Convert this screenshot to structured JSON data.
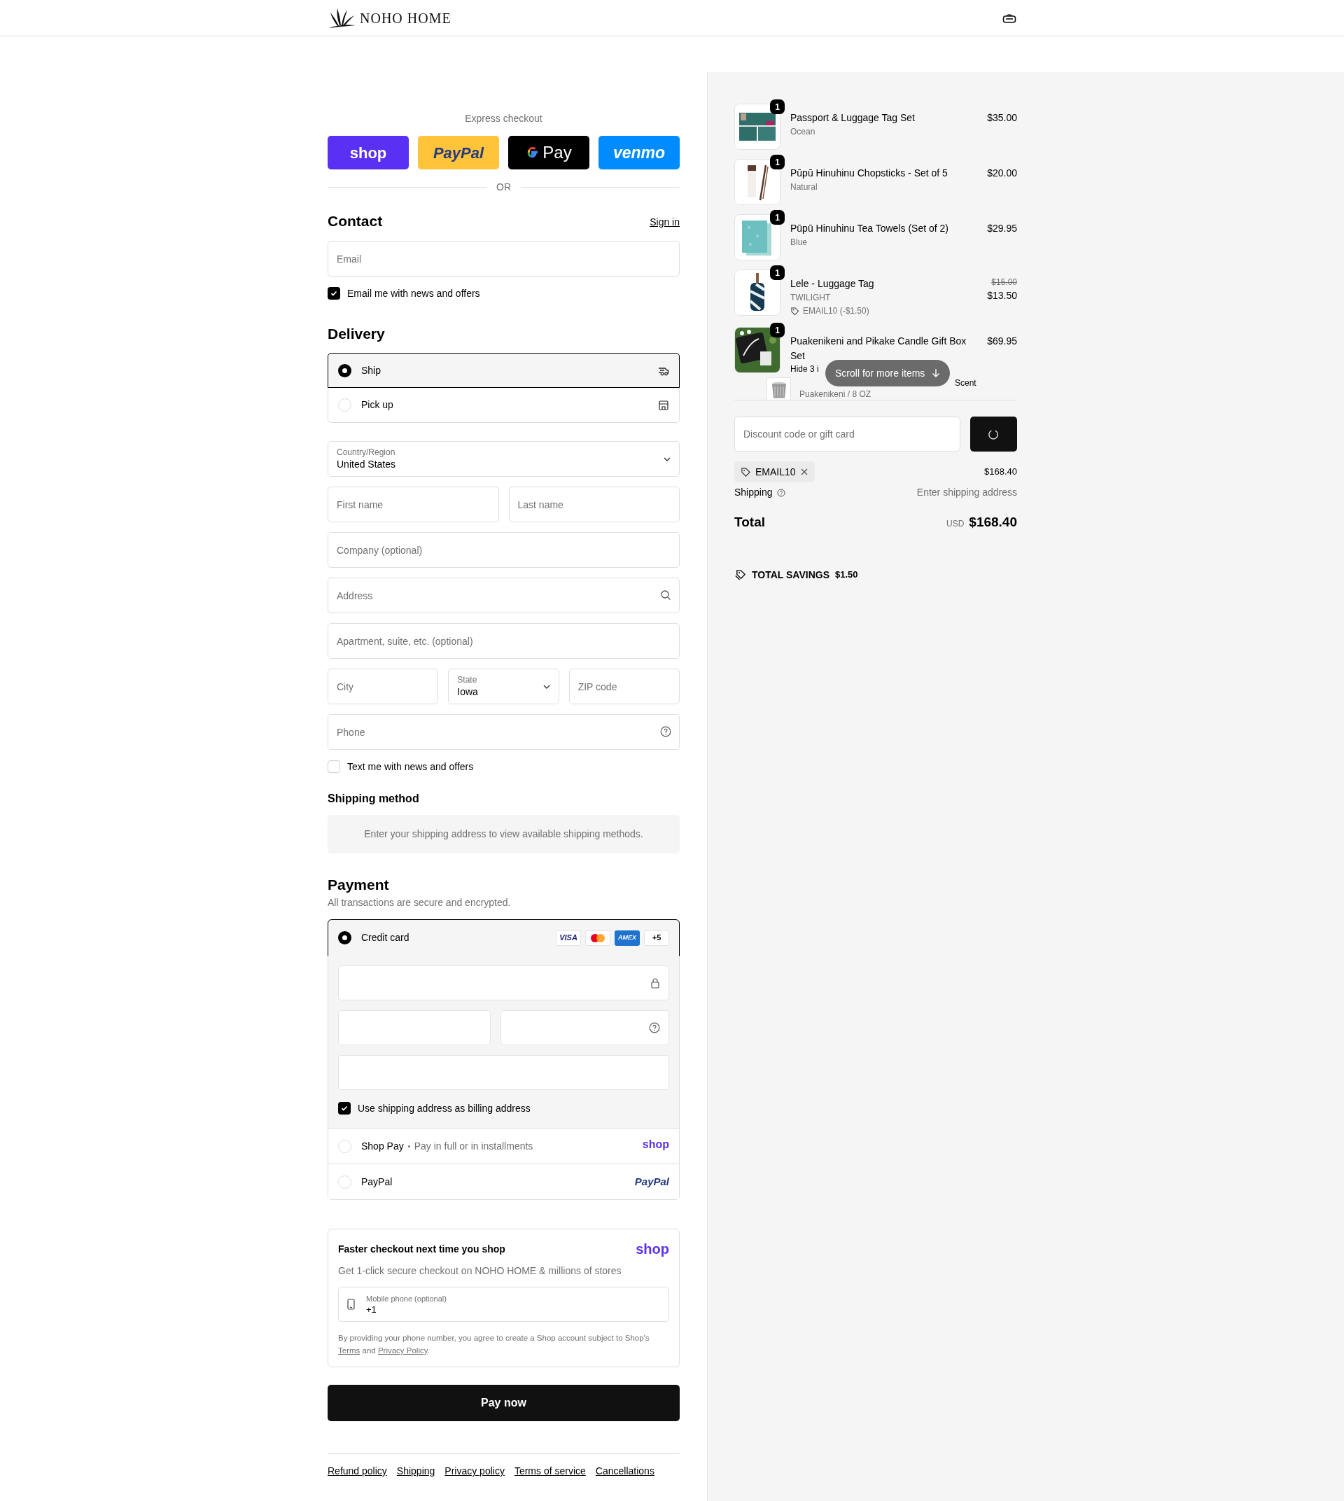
{
  "header": {
    "brand": "NOHO HOME"
  },
  "express_checkout": {
    "label": "Express checkout",
    "buttons": [
      {
        "kind": "shop",
        "label": "shop"
      },
      {
        "kind": "paypal",
        "label": "PayPal"
      },
      {
        "kind": "gpay",
        "label": "Pay"
      },
      {
        "kind": "venmo",
        "label": "venmo"
      }
    ],
    "divider": "OR"
  },
  "contact": {
    "title": "Contact",
    "sign_in": "Sign in",
    "email": {
      "placeholder": "Email"
    },
    "news": {
      "label": "Email me with news and offers",
      "checked": true
    }
  },
  "delivery": {
    "title": "Delivery",
    "options": [
      {
        "kind": "ship",
        "label": "Ship",
        "selected": true
      },
      {
        "kind": "pickup",
        "label": "Pick up",
        "selected": false
      }
    ],
    "rows": [
      [
        {
          "kind": "select",
          "label": "Country/Region",
          "value": "United States"
        }
      ],
      [
        {
          "kind": "input",
          "placeholder": "First name"
        },
        {
          "kind": "input",
          "placeholder": "Last name"
        }
      ],
      [
        {
          "kind": "input",
          "placeholder": "Company (optional)"
        }
      ],
      [
        {
          "kind": "search",
          "placeholder": "Address"
        }
      ],
      [
        {
          "kind": "input",
          "placeholder": "Apartment, suite, etc. (optional)"
        }
      ],
      [
        {
          "kind": "input",
          "placeholder": "City"
        },
        {
          "kind": "select",
          "label": "State",
          "value": "Iowa"
        },
        {
          "kind": "input",
          "placeholder": "ZIP code"
        }
      ],
      [
        {
          "kind": "help",
          "placeholder": "Phone"
        }
      ]
    ],
    "text_me": {
      "label": "Text me with news and offers",
      "checked": false
    }
  },
  "shipping_method": {
    "title": "Shipping method",
    "message": "Enter your shipping address to view available shipping methods."
  },
  "payment": {
    "title": "Payment",
    "subtitle": "All transactions are secure and encrypted.",
    "methods": [
      {
        "kind": "card",
        "label": "Credit card",
        "selected": true,
        "brands": [
          "VISA",
          "AMEX"
        ],
        "more": "+5"
      },
      {
        "kind": "shop_pay",
        "label": "Shop Pay",
        "note": "Pay in full or in installments",
        "logo": "shop",
        "selected": false
      },
      {
        "kind": "paypal",
        "label": "PayPal",
        "logo": "PayPal",
        "selected": false
      }
    ],
    "billing": {
      "label": "Use shipping address as billing address",
      "checked": true
    }
  },
  "shop_promo": {
    "title": "Faster checkout next time you shop",
    "logo": "shop",
    "subtitle": "Get 1-click secure checkout on NOHO HOME & millions of stores",
    "phone": {
      "label": "Mobile phone (optional)",
      "value": "+1"
    },
    "legal": {
      "text": "By providing your phone number, you agree to create a Shop account subject to Shop's",
      "links": [
        "Terms",
        "Privacy Policy"
      ],
      "joiner": "and",
      "end": "."
    }
  },
  "pay_button": "Pay now",
  "footer_links": [
    "Refund policy",
    "Shipping",
    "Privacy policy",
    "Terms of service",
    "Cancellations"
  ],
  "summary": {
    "items": [
      {
        "quantity": "1",
        "name": "Passport & Luggage Tag Set",
        "variant": "Ocean",
        "price": "$35.00"
      },
      {
        "quantity": "1",
        "name": "Pūpū Hinuhinu Chopsticks - Set of 5",
        "variant": "Natural",
        "price": "$20.00"
      },
      {
        "quantity": "1",
        "name": "Pūpū Hinuhinu Tea Towels (Set of 2)",
        "variant": "Blue",
        "price": "$29.95"
      },
      {
        "quantity": "1",
        "name": "Lele - Luggage Tag",
        "variant": "TWILIGHT",
        "discount": "EMAIL10 (-$1.50)",
        "original_price": "$15.00",
        "price": "$13.50"
      },
      {
        "quantity": "1",
        "name": "Puakenikeni and Pikake Candle Gift Box Set",
        "toggle": "Hide 3 i",
        "price": "$69.95",
        "sub_items": [
          {
            "name": "Scent",
            "variant": "Puakenikeni / 8 OZ"
          }
        ]
      }
    ],
    "scroll_hint": "Scroll for more items",
    "discount": {
      "placeholder": "Discount code or gift card"
    },
    "applied_code": "EMAIL10",
    "subtotal": "$168.40",
    "shipping": {
      "label": "Shipping",
      "value": "Enter shipping address"
    },
    "total": {
      "label": "Total",
      "currency": "USD",
      "value": "$168.40"
    },
    "savings": {
      "label": "TOTAL SAVINGS",
      "value": "$1.50"
    }
  }
}
